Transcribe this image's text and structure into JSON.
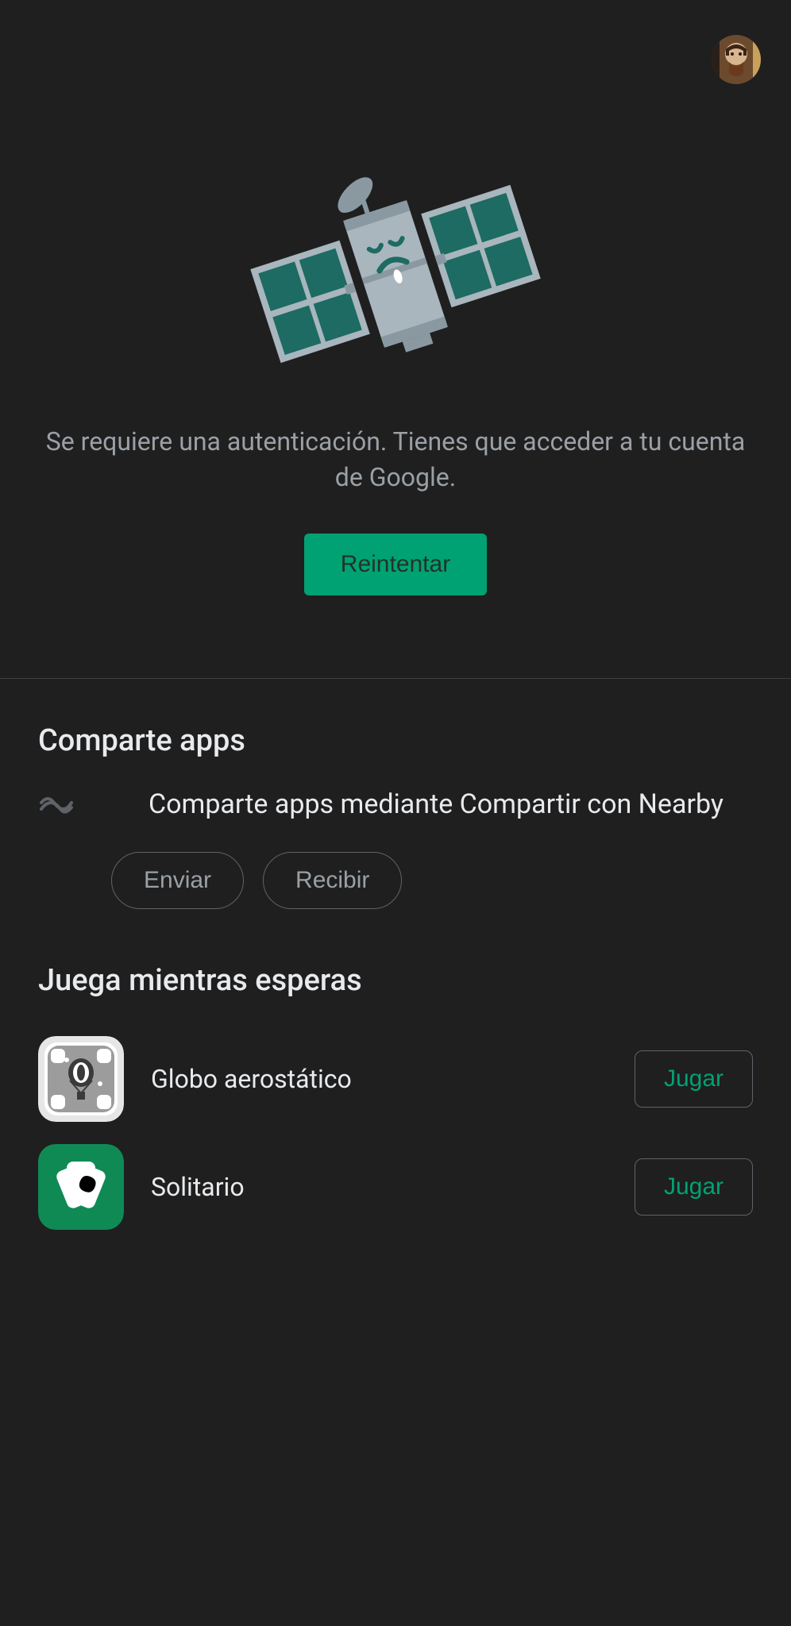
{
  "error": {
    "message": "Se requiere una autenticación. Tienes que acceder a tu cuenta de Google.",
    "retry_label": "Reintentar"
  },
  "share": {
    "title": "Comparte apps",
    "description": "Comparte apps mediante Compartir con Nearby",
    "send_label": "Enviar",
    "receive_label": "Recibir"
  },
  "play": {
    "title": "Juega mientras esperas",
    "games": [
      {
        "name": "Globo aerostático",
        "play_label": "Jugar",
        "icon": "balloon"
      },
      {
        "name": "Solitario",
        "play_label": "Jugar",
        "icon": "solitaire"
      }
    ]
  }
}
